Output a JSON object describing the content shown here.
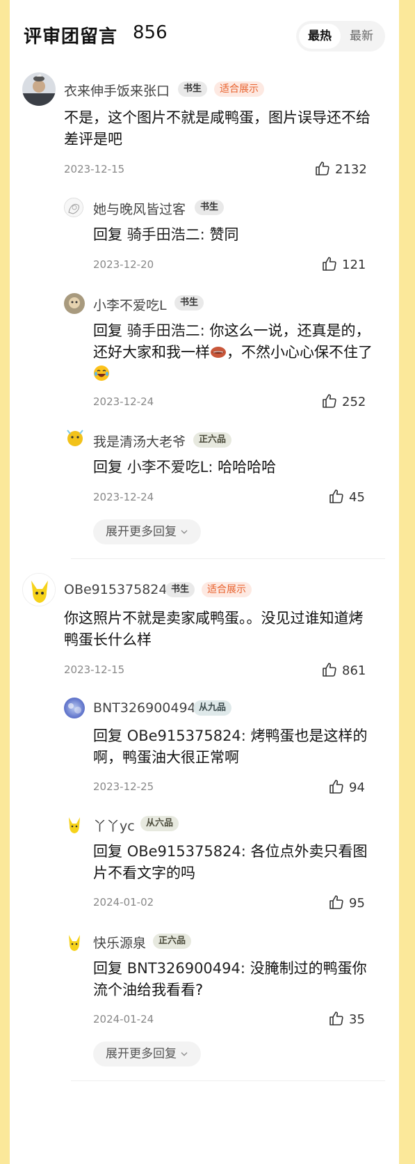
{
  "header": {
    "title": "评审团留言",
    "count": "856",
    "sort_hot": "最热",
    "sort_new": "最新"
  },
  "threads": [
    {
      "user": "衣来伸手饭来张口",
      "badge": "书生",
      "tag": "适合展示",
      "text": "不是，这个图片不就是咸鸭蛋，图片误导还不给差评是吧",
      "date": "2023-12-15",
      "likes": "2132",
      "replies": [
        {
          "user": "她与晚风皆过客",
          "badge": "书生",
          "reply_prefix": "回复",
          "reply_target": "骑手田浩二:",
          "text": "赞同",
          "date": "2023-12-20",
          "likes": "121"
        },
        {
          "user": "小李不爱吃L",
          "badge": "书生",
          "reply_prefix": "回复",
          "reply_target": "骑手田浩二:",
          "text": "你这么一说，还真是的，还好大家和我一样",
          "text_after": "，不然小心心保不住了",
          "date": "2023-12-24",
          "likes": "252"
        },
        {
          "user": "我是清汤大老爷",
          "badge": "正六品",
          "reply_prefix": "回复",
          "reply_target": "小李不爱吃L:",
          "text": "哈哈哈哈",
          "date": "2023-12-24",
          "likes": "45"
        }
      ],
      "more": "展开更多回复"
    },
    {
      "user": "OBe915375824",
      "badge": "书生",
      "tag": "适合展示",
      "text": "你这照片不就是卖家咸鸭蛋。。没见过谁知道烤鸭蛋长什么样",
      "date": "2023-12-15",
      "likes": "861",
      "replies": [
        {
          "user": "BNT326900494",
          "badge": "从九品",
          "reply_prefix": "回复",
          "reply_target": "OBe915375824:",
          "text": "烤鸭蛋也是这样的啊，鸭蛋油大很正常啊",
          "date": "2023-12-25",
          "likes": "94"
        },
        {
          "user": "丫丫yc",
          "badge": "从六品",
          "reply_prefix": "回复",
          "reply_target": "OBe915375824:",
          "text": "各位点外卖只看图片不看文字的吗",
          "date": "2024-01-02",
          "likes": "95"
        },
        {
          "user": "快乐源泉",
          "badge": "正六品",
          "reply_prefix": "回复",
          "reply_target": "BNT326900494:",
          "text": "没腌制过的鸭蛋你流个油给我看看?",
          "date": "2024-01-24",
          "likes": "35"
        }
      ],
      "more": "展开更多回复"
    }
  ],
  "icons": {
    "like": "thumbs-up-icon",
    "chevron": "chevron-down-icon",
    "emoji_lips": "lips-emoji-icon",
    "emoji_laugh": "laughing-tears-emoji-icon"
  }
}
